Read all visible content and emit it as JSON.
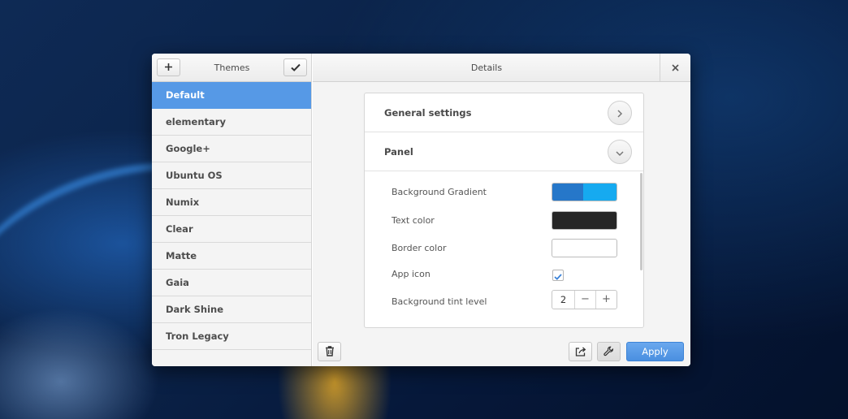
{
  "left_panel": {
    "title": "Themes",
    "add_icon": "plus-icon",
    "confirm_icon": "checkmark-icon",
    "themes": [
      {
        "label": "Default",
        "selected": true
      },
      {
        "label": "elementary"
      },
      {
        "label": "Google+"
      },
      {
        "label": "Ubuntu OS"
      },
      {
        "label": "Numix"
      },
      {
        "label": "Clear"
      },
      {
        "label": "Matte"
      },
      {
        "label": "Gaia"
      },
      {
        "label": "Dark Shine"
      },
      {
        "label": "Tron Legacy"
      }
    ],
    "delete_icon": "trash-icon"
  },
  "details": {
    "title": "Details",
    "close_icon": "close-icon",
    "sections": [
      {
        "label": "General settings",
        "icon": "chevron-right-icon"
      },
      {
        "label": "Panel",
        "icon": "chevron-down-icon"
      }
    ],
    "properties": {
      "background_gradient": {
        "label": "Background Gradient",
        "colors": [
          "#2677c9",
          "#16aaf0"
        ]
      },
      "text_color": {
        "label": "Text color",
        "color": "#262626"
      },
      "border_color": {
        "label": "Border color",
        "color": "#ffffff"
      },
      "app_icon": {
        "label": "App icon",
        "checked": true
      },
      "background_tint": {
        "label": "Background tint level",
        "value": "2",
        "decrement": "−",
        "increment": "+"
      }
    }
  },
  "footer": {
    "export_icon": "export-icon",
    "settings_icon": "wrench-icon",
    "apply_label": "Apply"
  },
  "colors": {
    "accent": "#5699e6",
    "apply_button": "#4a8fe0"
  }
}
